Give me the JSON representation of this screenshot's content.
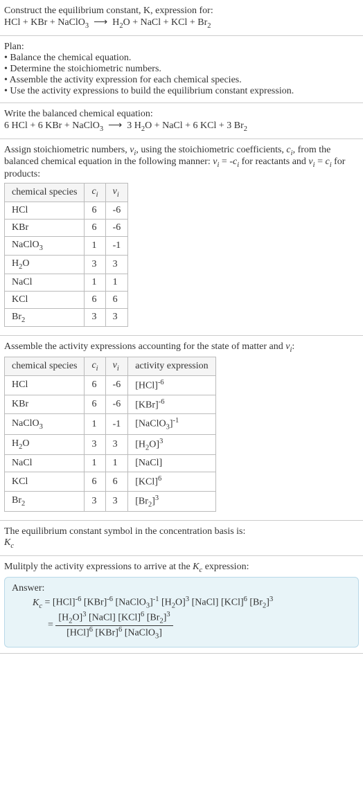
{
  "intro": {
    "line1": "Construct the equilibrium constant, K, expression for:",
    "eq_unbalanced": "HCl + KBr + NaClO₃  ⟶  H₂O + NaCl + KCl + Br₂"
  },
  "plan": {
    "head": "Plan:",
    "b1": "• Balance the chemical equation.",
    "b2": "• Determine the stoichiometric numbers.",
    "b3": "• Assemble the activity expression for each chemical species.",
    "b4": "• Use the activity expressions to build the equilibrium constant expression."
  },
  "balanced": {
    "head": "Write the balanced chemical equation:",
    "eq": "6 HCl + 6 KBr + NaClO₃  ⟶  3 H₂O + NaCl + 6 KCl + 3 Br₂"
  },
  "stoich_text": {
    "p1a": "Assign stoichiometric numbers, ",
    "p1b": ", using the stoichiometric coefficients, ",
    "p1c": ", from the balanced chemical equation in the following manner: ",
    "p1d": " for reactants and ",
    "p1e": " for products:"
  },
  "table1": {
    "h1": "chemical species",
    "rows": [
      {
        "sp": "HCl",
        "c": "6",
        "v": "-6"
      },
      {
        "sp": "KBr",
        "c": "6",
        "v": "-6"
      },
      {
        "sp": "NaClO₃",
        "c": "1",
        "v": "-1"
      },
      {
        "sp": "H₂O",
        "c": "3",
        "v": "3"
      },
      {
        "sp": "NaCl",
        "c": "1",
        "v": "1"
      },
      {
        "sp": "KCl",
        "c": "6",
        "v": "6"
      },
      {
        "sp": "Br₂",
        "c": "3",
        "v": "3"
      }
    ]
  },
  "assemble": {
    "p": "Assemble the activity expressions accounting for the state of matter and νᵢ:"
  },
  "table2": {
    "h1": "chemical species",
    "h4": "activity expression",
    "rows": [
      {
        "sp": "HCl",
        "c": "6",
        "v": "-6",
        "a_base": "[HCl]",
        "a_exp": "-6"
      },
      {
        "sp": "KBr",
        "c": "6",
        "v": "-6",
        "a_base": "[KBr]",
        "a_exp": "-6"
      },
      {
        "sp": "NaClO₃",
        "c": "1",
        "v": "-1",
        "a_base": "[NaClO₃]",
        "a_exp": "-1"
      },
      {
        "sp": "H₂O",
        "c": "3",
        "v": "3",
        "a_base": "[H₂O]",
        "a_exp": "3"
      },
      {
        "sp": "NaCl",
        "c": "1",
        "v": "1",
        "a_base": "[NaCl]",
        "a_exp": ""
      },
      {
        "sp": "KCl",
        "c": "6",
        "v": "6",
        "a_base": "[KCl]",
        "a_exp": "6"
      },
      {
        "sp": "Br₂",
        "c": "3",
        "v": "3",
        "a_base": "[Br₂]",
        "a_exp": "3"
      }
    ]
  },
  "kc_def": {
    "line": "The equilibrium constant symbol in the concentration basis is:"
  },
  "mult": {
    "line": "Mulitply the activity expressions to arrive at the Kc expression:"
  },
  "answer": {
    "head": "Answer:",
    "line1": "Kc = [HCl]⁻⁶ [KBr]⁻⁶ [NaClO₃]⁻¹ [H₂O]³ [NaCl] [KCl]⁶ [Br₂]³",
    "num": "[H₂O]³ [NaCl] [KCl]⁶ [Br₂]³",
    "den": "[HCl]⁶ [KBr]⁶ [NaClO₃]"
  },
  "chart_data": {
    "type": "table",
    "balanced_equation": "6 HCl + 6 KBr + NaClO3 -> 3 H2O + NaCl + 6 KCl + 3 Br2",
    "stoichiometry": [
      {
        "species": "HCl",
        "c_i": 6,
        "nu_i": -6
      },
      {
        "species": "KBr",
        "c_i": 6,
        "nu_i": -6
      },
      {
        "species": "NaClO3",
        "c_i": 1,
        "nu_i": -1
      },
      {
        "species": "H2O",
        "c_i": 3,
        "nu_i": 3
      },
      {
        "species": "NaCl",
        "c_i": 1,
        "nu_i": 1
      },
      {
        "species": "KCl",
        "c_i": 6,
        "nu_i": 6
      },
      {
        "species": "Br2",
        "c_i": 3,
        "nu_i": 3
      }
    ],
    "Kc_expression": "([H2O]^3 [NaCl] [KCl]^6 [Br2]^3) / ([HCl]^6 [KBr]^6 [NaClO3])"
  }
}
